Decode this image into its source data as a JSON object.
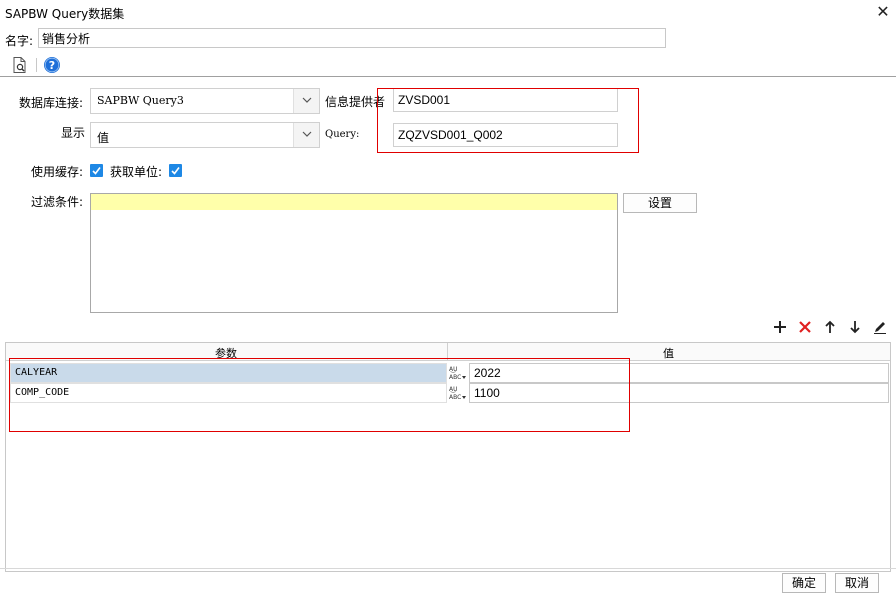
{
  "window": {
    "title": "SAPBW Query数据集",
    "close_glyph": "✕"
  },
  "name": {
    "label": "名字:",
    "value": "销售分析"
  },
  "toolbar": {
    "preview_icon": "preview-icon",
    "help_icon": "help-icon"
  },
  "connection": {
    "label": "数据库连接:",
    "value": "SAPBW Query3"
  },
  "info_provider": {
    "label": "信息提供者",
    "value": "ZVSD001"
  },
  "display": {
    "label": "显示",
    "value": "值"
  },
  "query": {
    "label": "Query:",
    "value": "ZQZVSD001_Q002"
  },
  "options": {
    "use_cache_label": "使用缓存:",
    "use_cache": true,
    "get_unit_label": "获取单位:",
    "get_unit": true
  },
  "filter": {
    "label": "过滤条件:",
    "set_button": "设置"
  },
  "grid_tools": [
    "add-icon",
    "delete-icon",
    "move-up-icon",
    "move-down-icon",
    "edit-icon"
  ],
  "params": {
    "headers": [
      "参数",
      "值"
    ],
    "rows": [
      {
        "name": "CALYEAR",
        "value": "2022",
        "type": "abc"
      },
      {
        "name": "COMP_CODE",
        "value": "1100",
        "type": "abc"
      }
    ]
  },
  "footer": {
    "ok": "确定",
    "cancel": "取消"
  },
  "colors": {
    "highlight_red": "#e00000",
    "checkbox_blue": "#1e88e5",
    "selected_row": "#c9daea",
    "filter_highlight": "#ffffaa"
  }
}
